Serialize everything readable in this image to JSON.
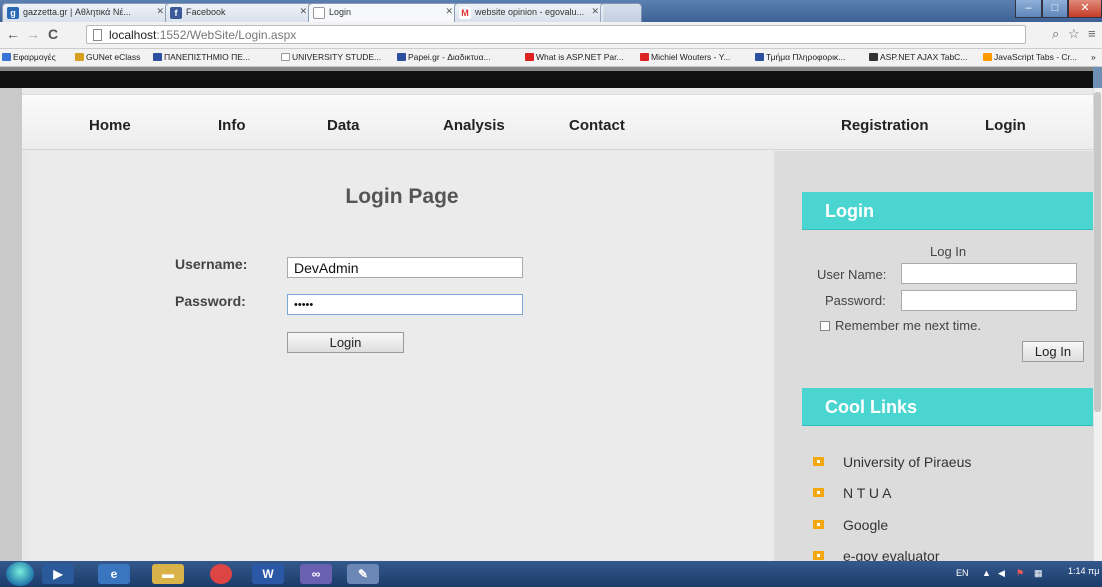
{
  "browser": {
    "tabs": [
      {
        "title": "gazzetta.gr | Αθλητικά Νέ...",
        "favicon": "gazzetta-icon"
      },
      {
        "title": "Facebook",
        "favicon": "facebook-icon"
      },
      {
        "title": "Login",
        "favicon": "page-icon"
      },
      {
        "title": "website opinion - egovalu...",
        "favicon": "gmail-icon"
      }
    ],
    "url_host": "localhost",
    "url_rest": ":1552/WebSite/Login.aspx",
    "bookmarks": [
      "Εφαρμογές",
      "GUNet eClass",
      "ΠΑΝΕΠΙΣΤΗΜΙΟ ΠΕ...",
      "UNIVERSITY STUDE...",
      "Papei.gr - Διαδικτυα...",
      "What is ASP.NET Par...",
      "Michiel Wouters - Y...",
      "Τμήμα Πληροφορικ...",
      "ASP.NET AJAX TabC...",
      "JavaScript Tabs - Cr..."
    ]
  },
  "nav": {
    "items": [
      "Home",
      "Info",
      "Data",
      "Analysis",
      "Contact"
    ],
    "registration": "Registration",
    "login": "Login"
  },
  "main": {
    "title": "Login Page",
    "username_label": "Username:",
    "username_value": "DevAdmin",
    "password_label": "Password:",
    "password_value": "•••••",
    "login_button": "Login"
  },
  "sidebar": {
    "login_header": "Login",
    "log_in_title": "Log In",
    "user_name_label": "User Name:",
    "password_label": "Password:",
    "remember_label": "Remember me next time.",
    "log_in_button": "Log In",
    "links_header": "Cool Links",
    "links": [
      "University of Piraeus",
      "N T U A",
      "Google",
      "e-gov evaluator"
    ]
  },
  "taskbar": {
    "lang": "EN",
    "time": "1:14 πμ"
  }
}
